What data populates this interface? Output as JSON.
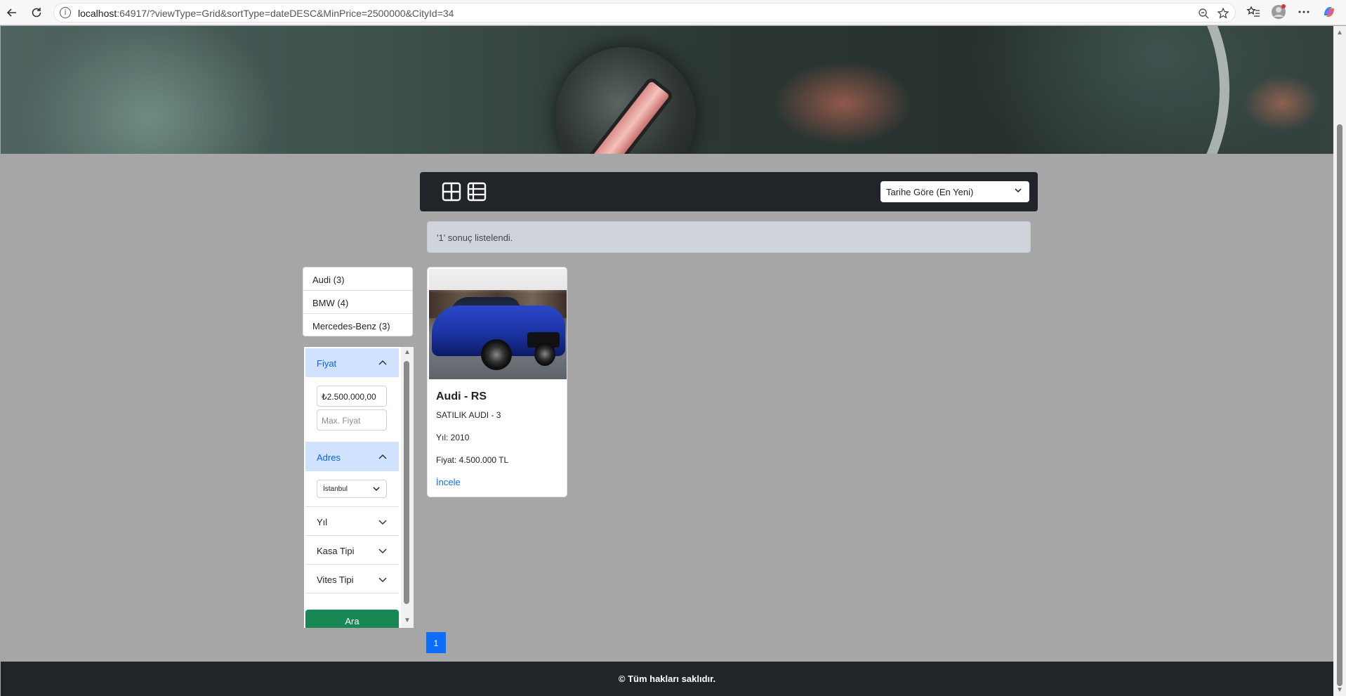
{
  "browser": {
    "url_host": "localhost",
    "url_rest": ":64917/?viewType=Grid&sortType=dateDESC&MinPrice=2500000&CityId=34"
  },
  "toolbar": {
    "sort_value": "Tarihe Göre (En Yeni)"
  },
  "results": {
    "message": "'1' sonuç listelendi."
  },
  "brands": [
    {
      "label": "Audi (3)"
    },
    {
      "label": "BMW (4)"
    },
    {
      "label": "Mercedes-Benz (3)"
    }
  ],
  "filters": {
    "price": {
      "label": "Fiyat",
      "min_value": "₺2.500.000,00",
      "max_placeholder": "Max. Fiyat"
    },
    "address": {
      "label": "Adres",
      "city": "İstanbul"
    },
    "year": {
      "label": "Yıl"
    },
    "body_type": {
      "label": "Kasa Tipi"
    },
    "gear_type": {
      "label": "Vites Tipi"
    },
    "search_label": "Ara"
  },
  "listing": {
    "title": "Audi - RS",
    "subtitle": "SATILIK AUDI - 3",
    "year": "Yıl: 2010",
    "price": "Fiyat: 4.500.000 TL",
    "link": "İncele"
  },
  "pagination": {
    "current": "1"
  },
  "footer": {
    "text": "© Tüm hakları saklıdır."
  },
  "colors": {
    "accent": "#0d6efd",
    "success": "#198754",
    "dark": "#212529",
    "accordion_open": "#cfe2ff"
  }
}
